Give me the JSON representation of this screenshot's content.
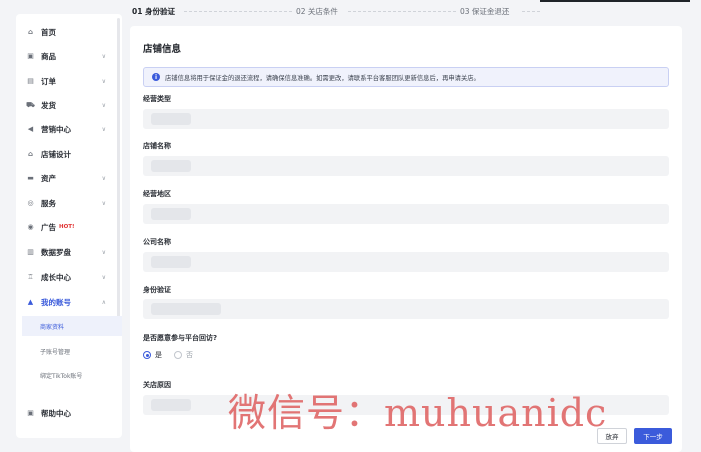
{
  "steps": [
    {
      "label": "01 身份验证"
    },
    {
      "label": "02 关店条件"
    },
    {
      "label": "03 保证金退还"
    }
  ],
  "sidebar": {
    "items": [
      {
        "label": "首页",
        "icon": "home-icon",
        "glyph": "⌂"
      },
      {
        "label": "商品",
        "icon": "product-icon",
        "glyph": "▣",
        "chevron": "∨"
      },
      {
        "label": "订单",
        "icon": "order-icon",
        "glyph": "▤",
        "chevron": "∨"
      },
      {
        "label": "发货",
        "icon": "delivery-icon",
        "glyph": "⛟",
        "chevron": "∨"
      },
      {
        "label": "营销中心",
        "icon": "marketing-icon",
        "glyph": "◀",
        "chevron": "∨"
      },
      {
        "label": "店铺设计",
        "icon": "store-design-icon",
        "glyph": "⌂"
      },
      {
        "label": "资产",
        "icon": "assets-icon",
        "glyph": "▬",
        "chevron": "∨"
      },
      {
        "label": "服务",
        "icon": "service-icon",
        "glyph": "◎",
        "chevron": "∨"
      },
      {
        "label": "广告",
        "icon": "ads-icon",
        "glyph": "◉",
        "badge": "HOT!"
      },
      {
        "label": "数据罗盘",
        "icon": "data-compass-icon",
        "glyph": "▥",
        "chevron": "∨"
      },
      {
        "label": "成长中心",
        "icon": "growth-icon",
        "glyph": "♖",
        "chevron": "∨"
      },
      {
        "label": "我的账号",
        "icon": "account-icon",
        "glyph": "▲",
        "chevron": "∧"
      }
    ],
    "sub_items": [
      {
        "label": "商家资料"
      },
      {
        "label": "子账号管理"
      },
      {
        "label": "绑定TikTok账号"
      }
    ],
    "help": {
      "label": "帮助中心",
      "icon": "help-icon",
      "glyph": "▣"
    }
  },
  "card": {
    "title": "店铺信息",
    "notice": "店铺信息将用于保证金的退还流程，请确保信息准确。如需更改，请联系平台客服团队更新信息后，再申请关店。"
  },
  "fields": [
    {
      "label": "经营类型"
    },
    {
      "label": "店铺名称"
    },
    {
      "label": "经营地区"
    },
    {
      "label": "公司名称"
    },
    {
      "label": "身份验证"
    }
  ],
  "participation": {
    "question": "是否愿意参与平台回访?",
    "options": [
      {
        "label": "是",
        "selected": true
      },
      {
        "label": "否",
        "selected": false
      }
    ]
  },
  "reason": {
    "label": "关店原因"
  },
  "buttons": {
    "secondary": "放弃",
    "primary": "下一步"
  },
  "watermark": "微信号：muhuanidc",
  "colors": {
    "accent": "#3b5bdb",
    "hot": "#e03131"
  }
}
